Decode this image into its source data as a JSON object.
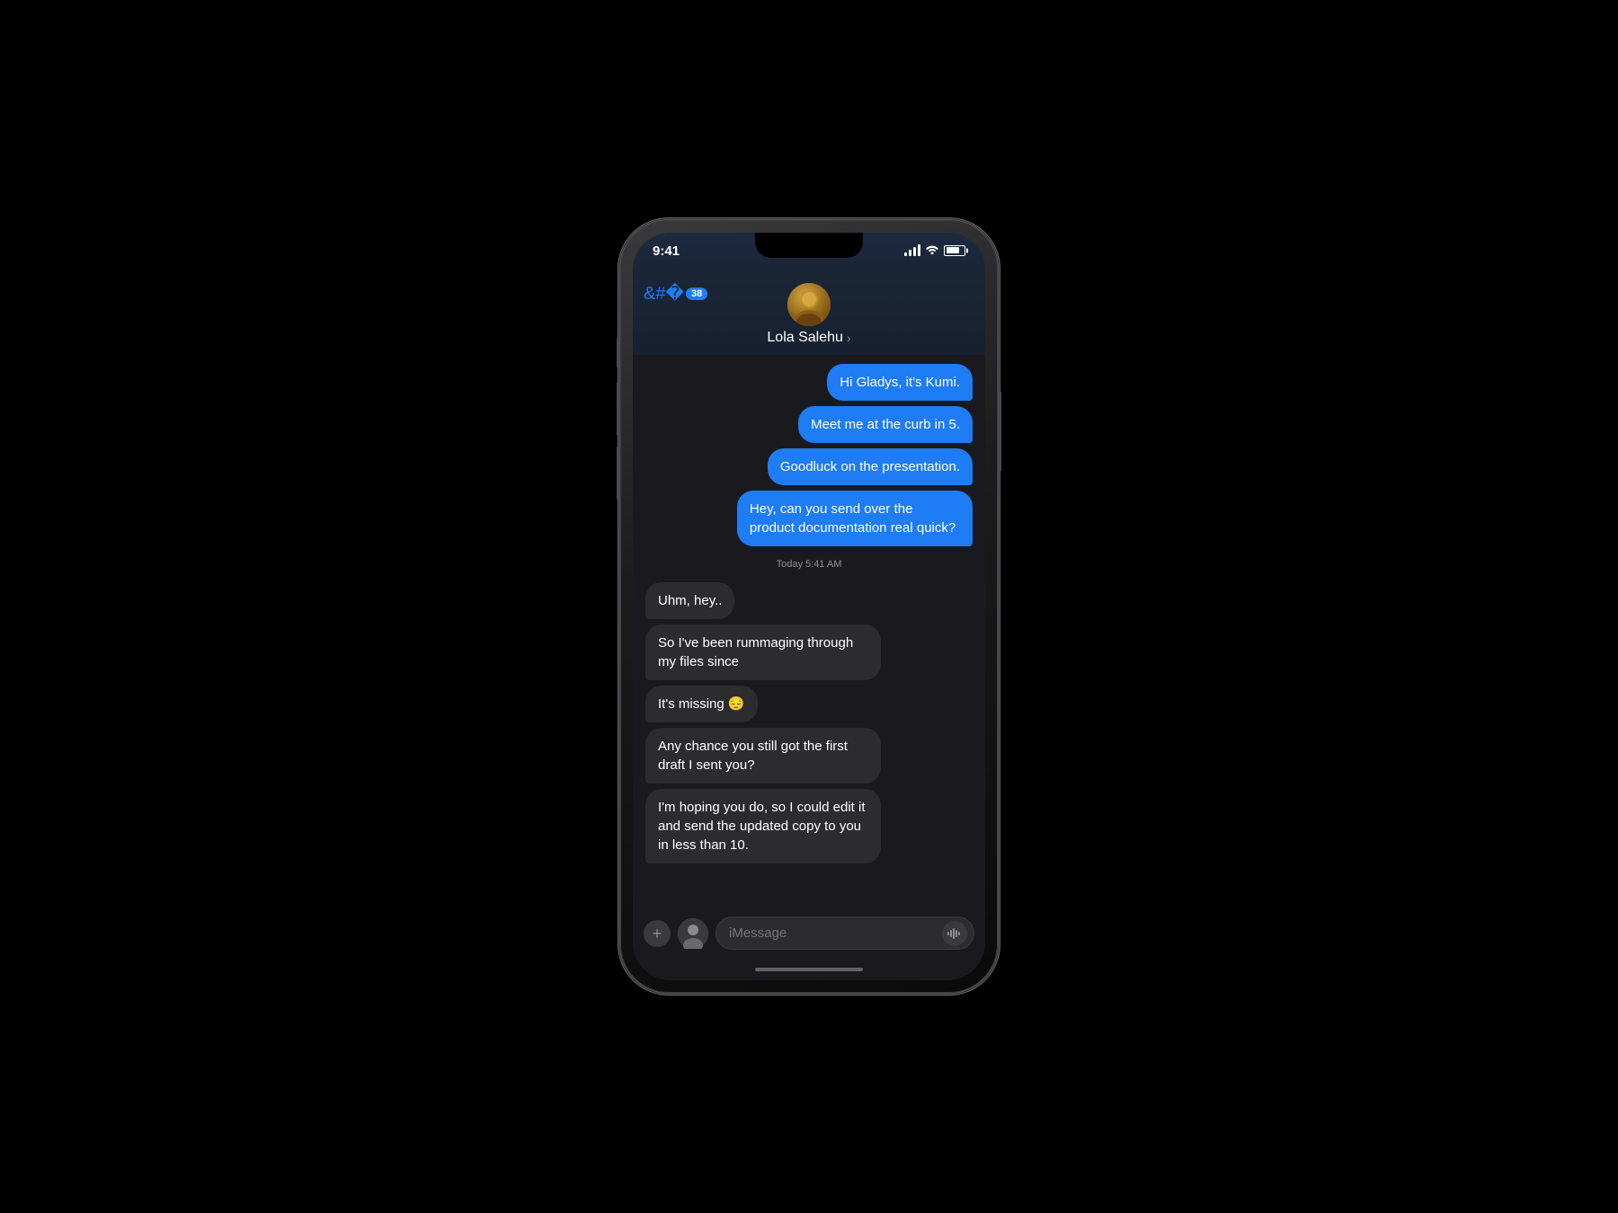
{
  "phone": {
    "status_time": "9:41",
    "back_badge": "38",
    "contact_name": "Lola Salehu",
    "timestamp": "Today 5:41 AM",
    "input_placeholder": "iMessage"
  },
  "messages": {
    "sent": [
      {
        "id": 1,
        "text": "Hi Gladys, it's Kumi."
      },
      {
        "id": 2,
        "text": "Meet me at the curb in 5."
      },
      {
        "id": 3,
        "text": "Goodluck on the presentation."
      },
      {
        "id": 4,
        "text": "Hey, can you send over the product documentation real quick?"
      }
    ],
    "received": [
      {
        "id": 5,
        "text": "Uhm, hey.."
      },
      {
        "id": 6,
        "text": "So I've been rummaging through my files since"
      },
      {
        "id": 7,
        "text": "It's missing 😔"
      },
      {
        "id": 8,
        "text": "Any chance you still got the first draft I sent you?"
      },
      {
        "id": 9,
        "text": "I'm hoping you do, so I could edit it and send the updated copy to you in less than 10."
      }
    ]
  }
}
